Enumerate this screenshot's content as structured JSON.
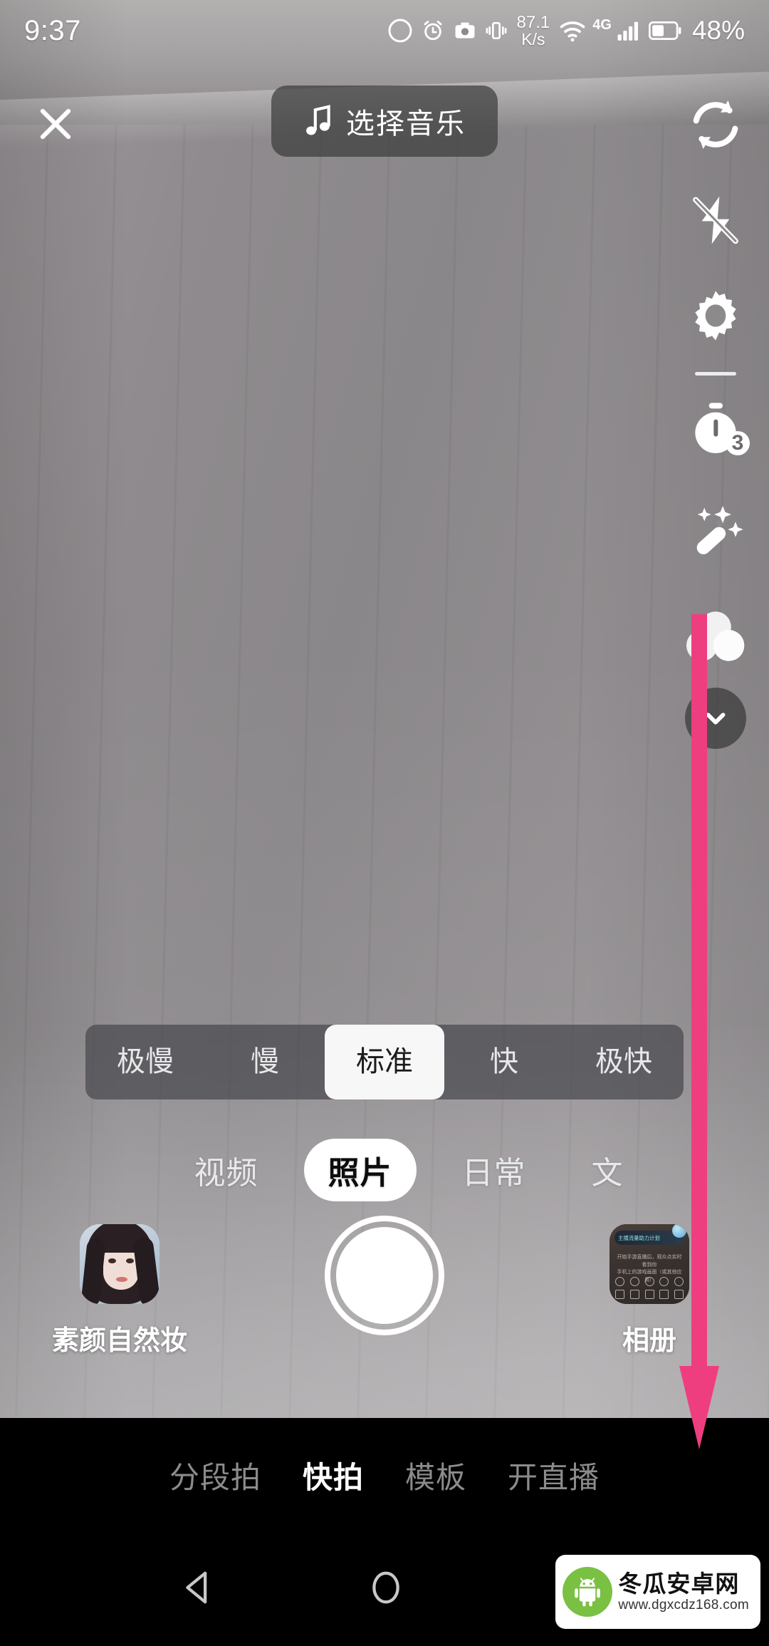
{
  "status_bar": {
    "time": "9:37",
    "net_speed_value": "87.1",
    "net_speed_unit": "K/s",
    "network_type": "4G",
    "battery_percent": "48%",
    "icons": [
      "eye-care-icon",
      "alarm-icon",
      "camera-icon",
      "vibrate-icon",
      "wifi-icon",
      "signal-icon",
      "battery-icon"
    ]
  },
  "top_controls": {
    "close_label": "close-icon",
    "music_label": "选择音乐",
    "music_icon": "music-note-icon"
  },
  "right_rail": {
    "items": [
      {
        "name": "flip-camera",
        "icon": "flip-camera-icon"
      },
      {
        "name": "flash",
        "icon": "flash-off-icon"
      },
      {
        "name": "settings",
        "icon": "gear-icon"
      },
      {
        "name": "timer",
        "icon": "timer-icon",
        "badge": "3"
      },
      {
        "name": "beauty",
        "icon": "magic-wand-icon"
      },
      {
        "name": "filters",
        "icon": "filter-circles-icon"
      }
    ],
    "collapse_icon": "chevron-down-icon"
  },
  "speed_bar": {
    "options": [
      "极慢",
      "慢",
      "标准",
      "快",
      "极快"
    ],
    "selected": "标准"
  },
  "mode_tabs": {
    "tabs": [
      "视频",
      "照片",
      "日常",
      "文"
    ],
    "selected": "照片"
  },
  "capture_row": {
    "beauty_filter_label": "素颜自然妆",
    "shutter_label": "shutter-button",
    "album_label": "相册",
    "album_preview": {
      "banner": "主播流量助力计划",
      "body_line1": "开始手游直播后，观众点实时看到你",
      "body_line2": "手机上的游戏画面（或其他应用）"
    }
  },
  "bottom_nav": {
    "items": [
      "分段拍",
      "快拍",
      "模板",
      "开直播"
    ],
    "selected": "快拍"
  },
  "android_nav": {
    "items": [
      "back-button",
      "home-button",
      "recents-button"
    ]
  },
  "watermark": {
    "name": "冬瓜安卓网",
    "url": "www.dgxcdz168.com"
  },
  "annotation": {
    "type": "arrow",
    "color": "#ee3e7f",
    "direction": "down",
    "points_to": "开直播"
  },
  "colors": {
    "accent_pink": "#ee3e7f",
    "preview_gray": "#8d8a8c",
    "chip_dark": "rgba(72,72,78,0.72)",
    "selected_white": "#ffffff",
    "nav_inactive": "#8b8b8b"
  }
}
